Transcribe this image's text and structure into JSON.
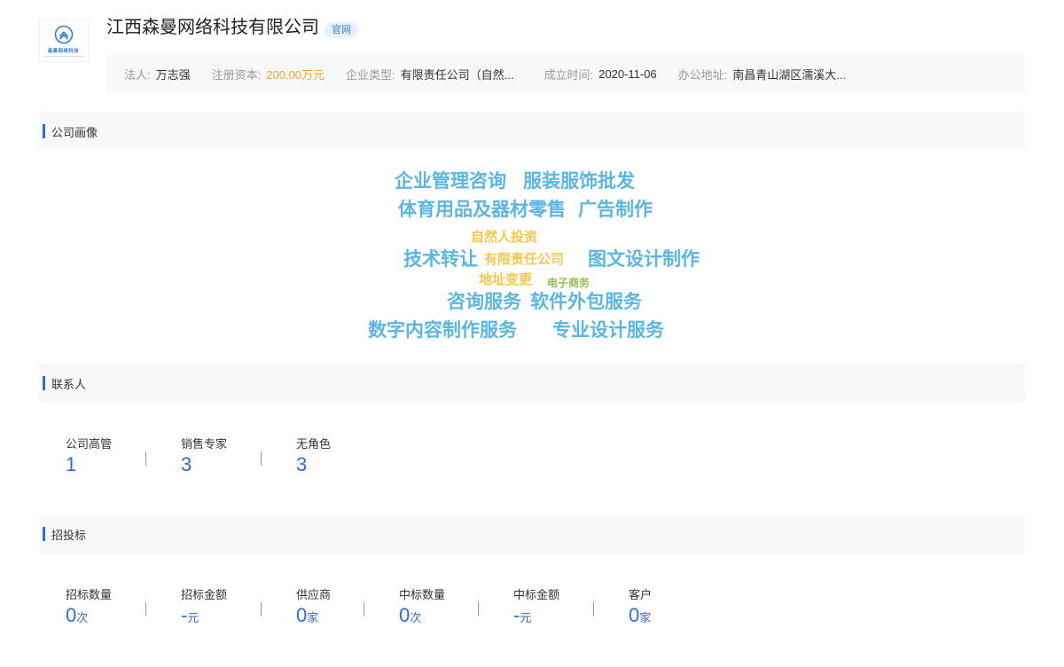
{
  "header": {
    "logo_text": "森曼网络科技",
    "company_name": "江西森曼网络科技有限公司",
    "site_tag": "官网",
    "info": [
      {
        "label": "法人:",
        "value": "万志强"
      },
      {
        "label": "注册资本:",
        "value": "200.00万元"
      },
      {
        "label": "企业类型:",
        "value": "有限责任公司（自然..."
      },
      {
        "label": "成立时间:",
        "value": "2020-11-06"
      },
      {
        "label": "办公地址:",
        "value": "南昌青山湖区濡溪大..."
      }
    ]
  },
  "portrait": {
    "title": "公司画像",
    "words": [
      "企业管理咨询",
      "服装服饰批发",
      "体育用品及器材零售",
      "广告制作",
      "自然人投资",
      "技术转让",
      "有限责任公司",
      "图文设计制作",
      "地址变更",
      "电子商务",
      "咨询服务",
      "软件外包服务",
      "数字内容制作服务",
      "专业设计服务"
    ],
    "colors": {
      "primary": "#59b6e6",
      "secondary": "#f6c74b",
      "tertiary": "#8bc34a"
    }
  },
  "contacts": {
    "title": "联系人",
    "stats": [
      {
        "label": "公司高管",
        "value": "1"
      },
      {
        "label": "销售专家",
        "value": "3"
      },
      {
        "label": "无角色",
        "value": "3"
      }
    ]
  },
  "bidding": {
    "title": "招投标",
    "stats": [
      {
        "label": "招标数量",
        "value": "0",
        "unit": "次"
      },
      {
        "label": "招标金额",
        "value": "-",
        "unit": "元"
      },
      {
        "label": "供应商",
        "value": "0",
        "unit": "家"
      },
      {
        "label": "中标数量",
        "value": "0",
        "unit": "次"
      },
      {
        "label": "中标金额",
        "value": "-",
        "unit": "元"
      },
      {
        "label": "客户",
        "value": "0",
        "unit": "家"
      }
    ]
  },
  "accent_color": "#2d6be4"
}
